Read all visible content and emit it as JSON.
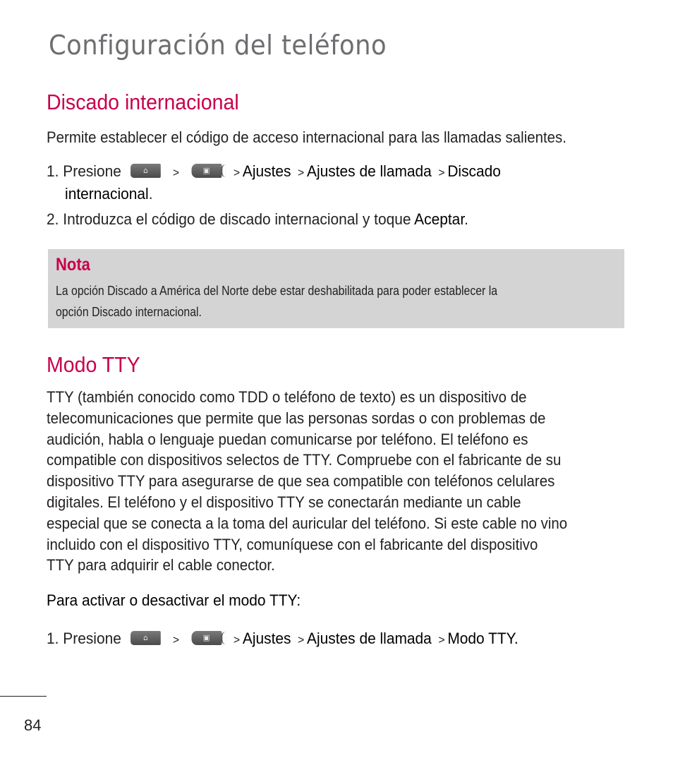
{
  "page": {
    "title": "Configuración del teléfono",
    "number": "84"
  },
  "international_dialing": {
    "heading": "Discado internacional",
    "intro": "Permite establecer el código de acceso internacional para las llamadas salientes.",
    "step1": {
      "number": "1.",
      "press": "Presione",
      "sep": ">",
      "path": [
        "Ajustes",
        "Ajustes de llamada",
        "Discado"
      ],
      "path_cont": "internacional",
      "end": "."
    },
    "step2": {
      "number": "2.",
      "text": "Introduzca el código de discado internacional y toque",
      "action": "Aceptar",
      "end": "."
    }
  },
  "note": {
    "title": "Nota",
    "lines": [
      "La opción Discado a América del Norte debe estar deshabilitada para poder establecer la",
      "opción Discado internacional."
    ]
  },
  "tty_mode": {
    "heading": "Modo TTY",
    "paragraph_lines": [
      "TTY (también conocido como TDD o teléfono de texto) es un dispositivo de",
      "telecomunicaciones que permite que las personas sordas o con problemas de",
      "audición, habla o lenguaje puedan comunicarse por teléfono. El teléfono es",
      "compatible con dispositivos selectos de TTY. Compruebe con el fabricante de su",
      "dispositivo TTY para asegurarse de que sea compatible con teléfonos celulares",
      "digitales. El teléfono y el dispositivo TTY se conectarán mediante un cable",
      "especial que se conecta a la toma del auricular del teléfono. Si este cable no vino",
      "incluido con el dispositivo TTY, comuníquese con el fabricante del dispositivo",
      "TTY para adquirir el cable conector."
    ],
    "subheading": "Para activar o desactivar el modo TTY:",
    "step1": {
      "number": "1.",
      "press": "Presione",
      "sep": ">",
      "path": [
        "Ajustes",
        "Ajustes de llamada",
        "Modo TTY."
      ]
    }
  },
  "icons": {
    "home_key": "home-icon",
    "menu_key": "menu-icon"
  }
}
